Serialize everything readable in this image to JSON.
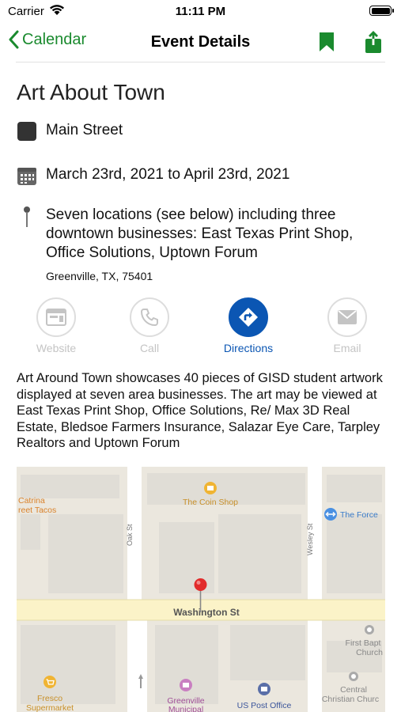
{
  "status_bar": {
    "carrier": "Carrier",
    "time": "11:11 PM"
  },
  "nav": {
    "back_label": "Calendar",
    "title": "Event Details",
    "accent_color": "#1a8a2e"
  },
  "event": {
    "title": "Art About Town",
    "category": "Main Street",
    "dates": "March 23rd, 2021 to April 23rd, 2021",
    "location": "Seven locations (see below) including three downtown businesses: East Texas Print Shop, Office Solutions, Uptown Forum",
    "address": "Greenville, TX, 75401",
    "description": "Art Around Town showcases 40 pieces of GISD student artwork displayed at seven area businesses. The art may be viewed at East Texas Print Shop, Office Solutions, Re/ Max 3D Real Estate, Bledsoe Farmers Insurance, Salazar Eye Care, Tarpley Realtors and Uptown Forum"
  },
  "actions": {
    "website": "Website",
    "call": "Call",
    "directions": "Directions",
    "email": "Email",
    "active_color": "#0b56b3",
    "disabled_color": "#c4c4c4"
  },
  "map": {
    "streets": {
      "washington": "Washington St",
      "oak": "Oak St",
      "wesley": "Wesley St"
    },
    "places": {
      "catrina_line1": "Catrina",
      "catrina_line2": "reet Tacos",
      "coin_shop": "The Coin Shop",
      "the_force": "The Force",
      "first_bapt_line1": "First Bapt",
      "first_bapt_line2": "Church",
      "central_line1": "Central",
      "central_line2": "Christian Churc",
      "fresco_line1": "Fresco",
      "fresco_line2": "Supermarket",
      "greenville_line1": "Greenville",
      "greenville_line2": "Municipal",
      "post_office": "US Post Office"
    }
  }
}
